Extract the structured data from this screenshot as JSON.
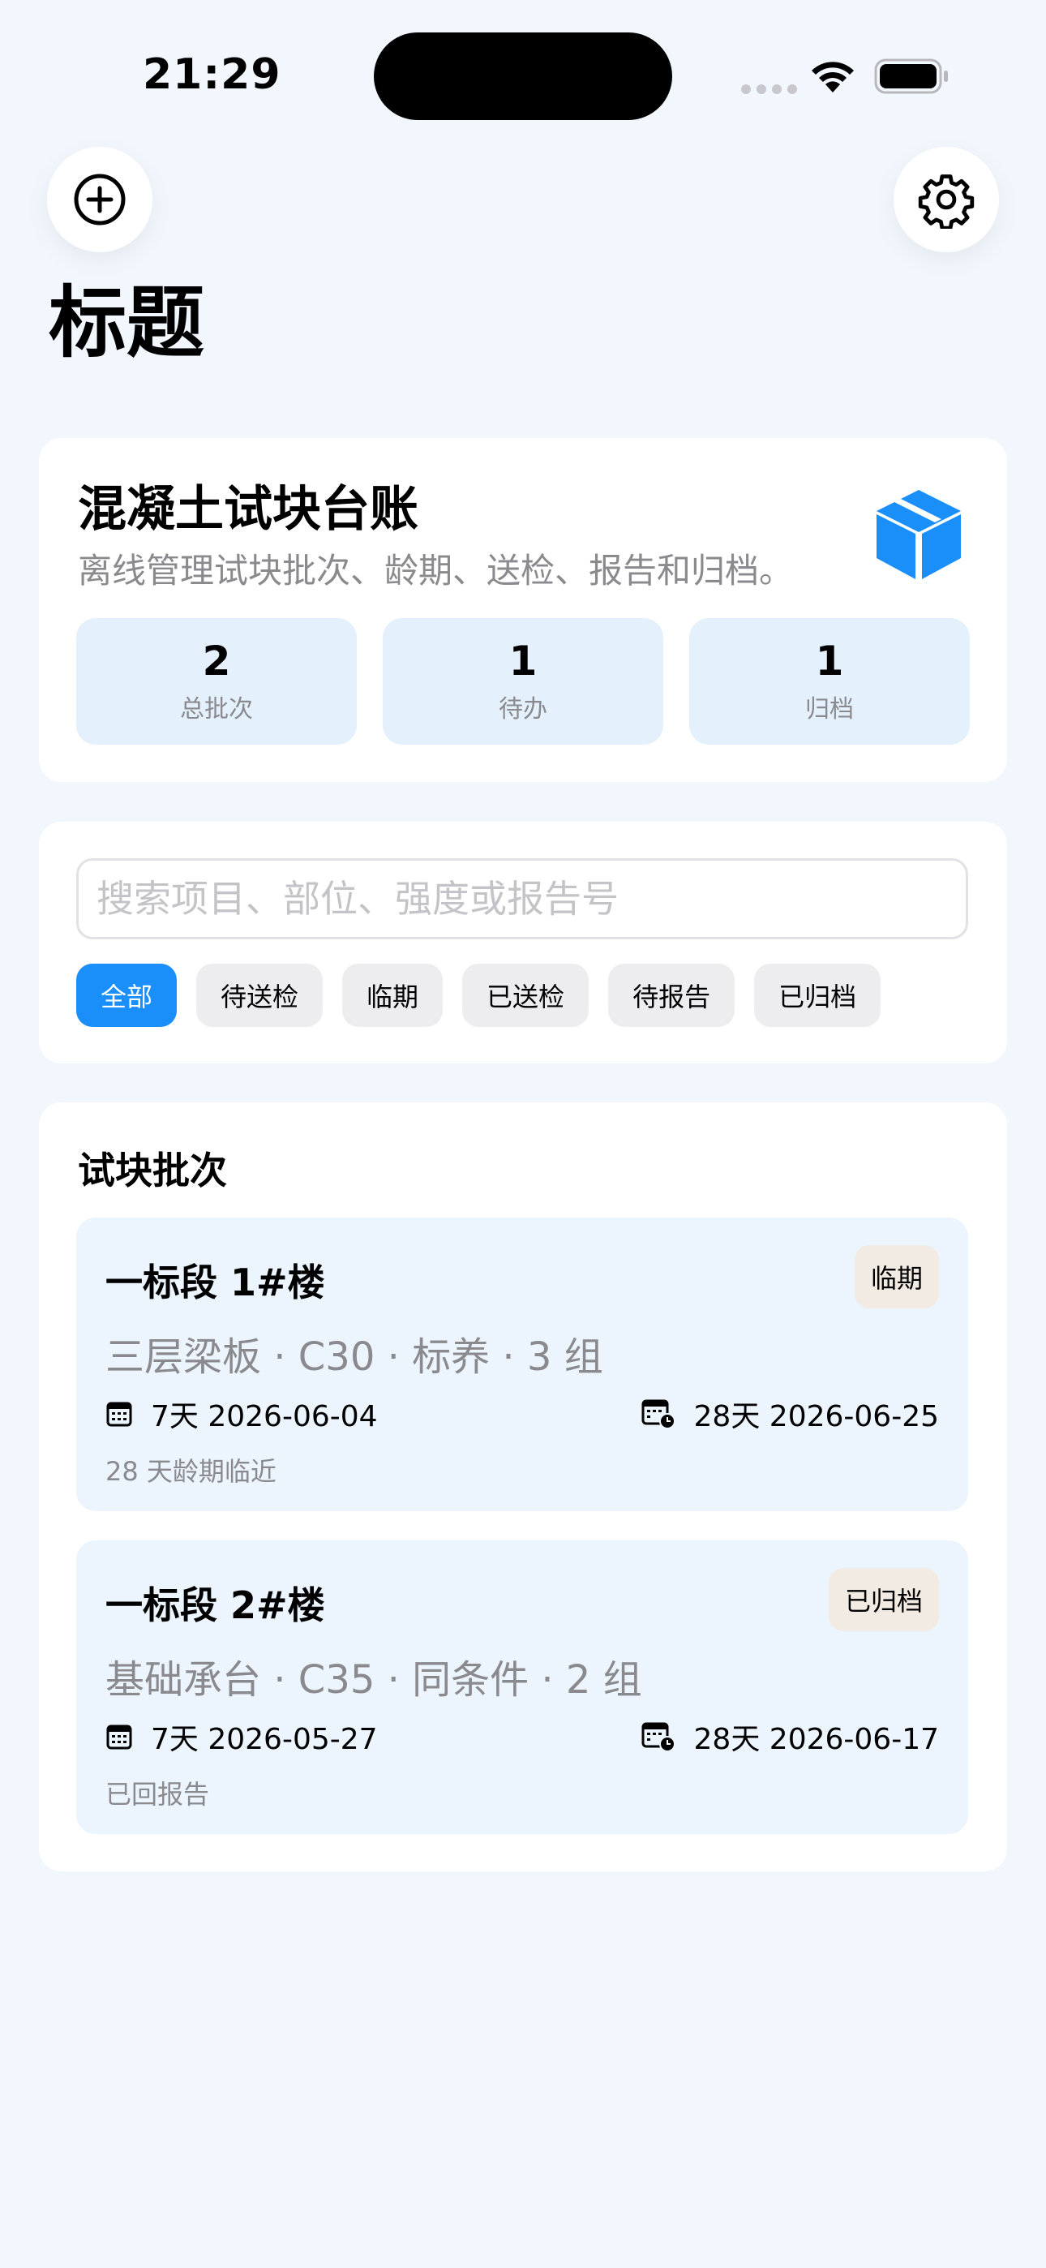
{
  "status_bar": {
    "time": "21:29"
  },
  "header": {
    "title": "标题"
  },
  "summary": {
    "title": "混凝土试块台账",
    "subtitle": "离线管理试块批次、龄期、送检、报告和归档。",
    "stats": [
      {
        "value": "2",
        "label": "总批次"
      },
      {
        "value": "1",
        "label": "待办"
      },
      {
        "value": "1",
        "label": "归档"
      }
    ]
  },
  "search": {
    "placeholder": "搜索项目、部位、强度或报告号",
    "value": ""
  },
  "filters": {
    "selected": "全部",
    "items": [
      "全部",
      "待送检",
      "临期",
      "已送检",
      "待报告",
      "已归档"
    ]
  },
  "list": {
    "title": "试块批次",
    "batches": [
      {
        "name": "一标段 1#楼",
        "badge": "临期",
        "meta": "三层梁板 · C30 · 标养 · 3 组",
        "day7": "7天 2026-06-04",
        "day28": "28天 2026-06-25",
        "note": "28 天龄期临近"
      },
      {
        "name": "一标段 2#楼",
        "badge": "已归档",
        "meta": "基础承台 · C35 · 同条件 · 2 组",
        "day7": "7天 2026-05-27",
        "day28": "28天 2026-06-17",
        "note": "已回报告"
      }
    ]
  },
  "colors": {
    "accent": "#1a8ffa",
    "background": "#f2f7fd",
    "stat_bg": "#e4f1fd",
    "batch_bg": "#ecf4fe",
    "badge_bg": "#f1ebe3"
  },
  "icons": [
    "add-circle-icon",
    "gear-icon",
    "box-icon",
    "calendar-icon",
    "calendar-clock-icon",
    "wifi-icon",
    "battery-icon"
  ]
}
